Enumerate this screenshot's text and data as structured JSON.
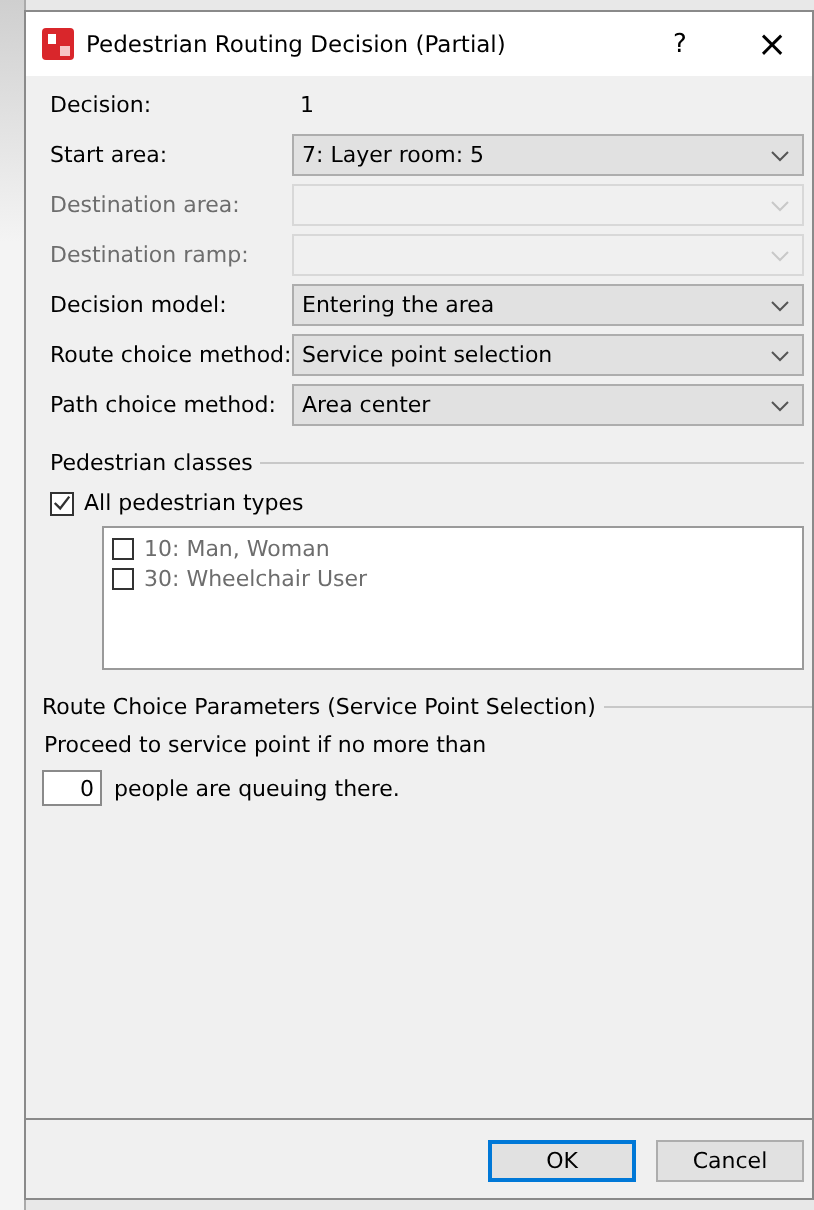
{
  "window": {
    "title": "Pedestrian Routing Decision (Partial)",
    "help": "?",
    "close": "×"
  },
  "fields": [
    {
      "label": "Decision:",
      "kind": "text",
      "value": "1"
    },
    {
      "label": "Start area:",
      "kind": "combo",
      "value": "7: Layer room: 5",
      "disabled": false
    },
    {
      "label": "Destination area:",
      "kind": "combo",
      "disabled": true
    },
    {
      "label": "Destination ramp:",
      "kind": "combo",
      "disabled": true
    },
    {
      "label": "Decision model:",
      "kind": "combo",
      "value": "Entering the area",
      "disabled": false
    },
    {
      "label": "Route choice method:",
      "kind": "combo",
      "value": "Service point selection",
      "disabled": false
    },
    {
      "label": "Path choice method:",
      "kind": "combo",
      "value": "Area center",
      "disabled": false
    }
  ],
  "pedestrian_classes": {
    "title": "Pedestrian classes",
    "all": {
      "label": "All pedestrian types",
      "checked": true
    },
    "items": [
      {
        "label": "10: Man, Woman",
        "checked": false
      },
      {
        "label": "30: Wheelchair User",
        "checked": false
      }
    ]
  },
  "route_choice_parameters": {
    "title": "Route Choice Parameters (Service Point Selection)",
    "text": "Proceed to service point if no more than",
    "value": "0",
    "suffix": "people are queuing there."
  },
  "buttons": [
    {
      "label": "OK",
      "default": true
    },
    {
      "label": "Cancel",
      "default": false
    }
  ]
}
